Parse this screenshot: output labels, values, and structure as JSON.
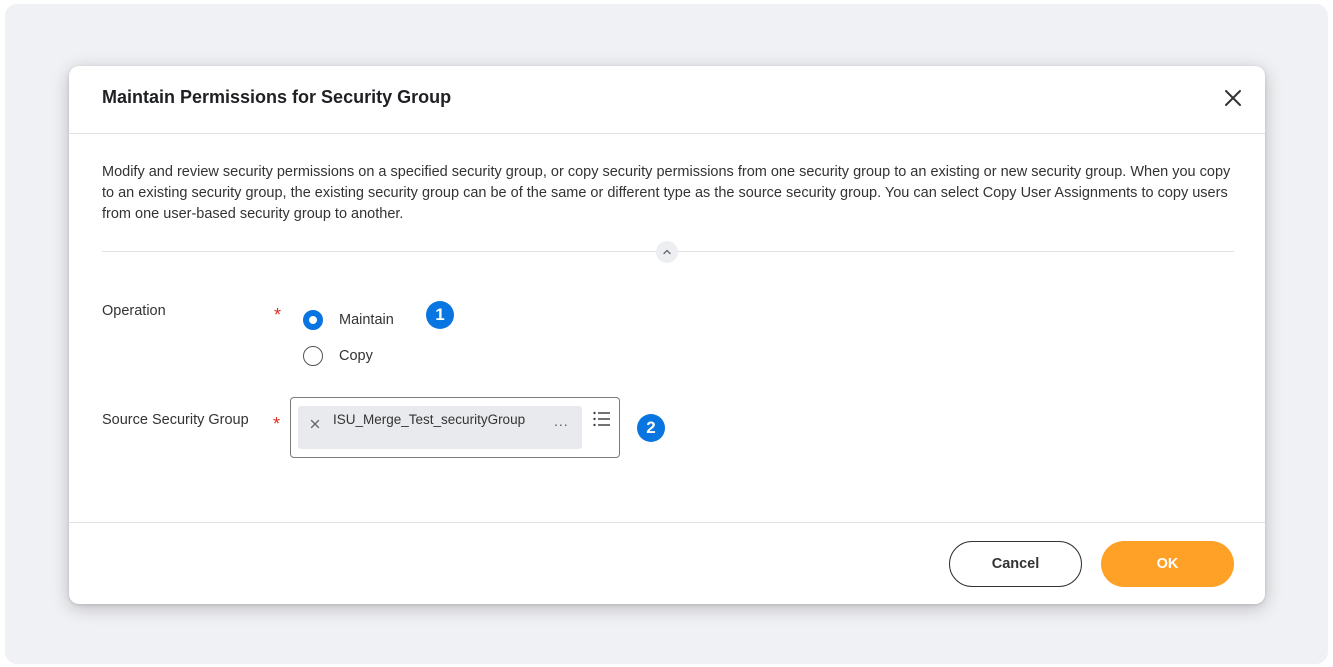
{
  "dialog": {
    "title": "Maintain Permissions for Security Group",
    "description": "Modify and review security permissions on a specified security group, or copy security permissions from one security group to an existing or new security group. When you copy to an existing security group, the existing security group can be of the same or different type as the source security group. You can select Copy User Assignments to copy users from one user-based security group to another."
  },
  "form": {
    "operation": {
      "label": "Operation",
      "required_mark": "*",
      "options": [
        {
          "label": "Maintain",
          "selected": true
        },
        {
          "label": "Copy",
          "selected": false
        }
      ]
    },
    "source_security_group": {
      "label": "Source Security Group",
      "required_mark": "*",
      "selected_value": "ISU_Merge_Test_securityGroup",
      "more_label": "..."
    }
  },
  "annotations": {
    "badge1": "1",
    "badge2": "2"
  },
  "footer": {
    "cancel_label": "Cancel",
    "ok_label": "OK"
  },
  "colors": {
    "accent_blue": "#0875e1",
    "ok_orange": "#ffa126",
    "required_red": "#de2e21"
  },
  "icons": [
    "close-icon",
    "chevron-up-icon",
    "remove-x-icon",
    "list-icon"
  ]
}
